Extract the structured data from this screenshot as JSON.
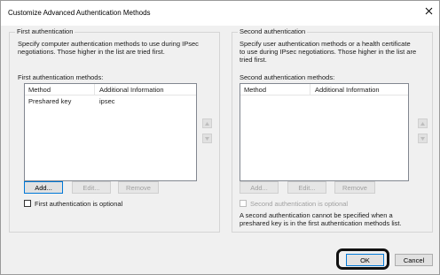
{
  "window": {
    "title": "Customize Advanced Authentication Methods",
    "close_glyph": "×"
  },
  "first_auth": {
    "legend": "First authentication",
    "description_line1": "Specify computer authentication methods to use during IPsec",
    "description_line2": "negotiations.  Those higher in the list are tried first.",
    "list_label": "First authentication methods:",
    "columns": [
      "Method",
      "Additional Information"
    ],
    "rows": [
      {
        "method": "Preshared key",
        "info": "ipsec"
      }
    ],
    "buttons": {
      "add": "Add...",
      "edit": "Edit...",
      "remove": "Remove"
    },
    "optional_label": "First authentication is optional",
    "optional_checked": false
  },
  "second_auth": {
    "legend": "Second authentication",
    "description_line1": "Specify user authentication methods or a health certificate",
    "description_line2": "to use during IPsec negotiations.  Those higher in the list are",
    "description_line3": "tried first.",
    "list_label": "Second authentication methods:",
    "columns": [
      "Method",
      "Additional Information"
    ],
    "rows": [],
    "buttons": {
      "add": "Add...",
      "edit": "Edit...",
      "remove": "Remove"
    },
    "optional_label": "Second authentication is optional",
    "optional_checked": false,
    "note_line1": "A second authentication cannot be specified when a",
    "note_line2": "preshared key is in the first authentication methods list."
  },
  "footer": {
    "ok": "OK",
    "cancel": "Cancel"
  },
  "icons": {
    "up": "up-arrow-icon",
    "down": "down-arrow-icon",
    "close": "close-icon"
  },
  "colors": {
    "highlight_ring": "#111111",
    "focus_border": "#0078d7"
  }
}
